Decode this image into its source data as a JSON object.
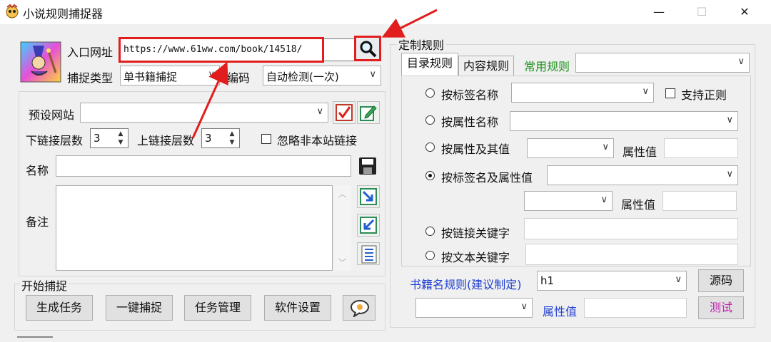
{
  "window": {
    "title": "小说规则捕捉器",
    "min_glyph": "—",
    "max_glyph": "☐",
    "close_glyph": "✕"
  },
  "left": {
    "entry_label": "入口网址",
    "entry_url": "https://www.61ww.com/book/14518/",
    "capture_type_label": "捕捉类型",
    "capture_type_value": "单书籍捕捉",
    "encoding_label": "编码",
    "encoding_value": "自动检测(一次)",
    "preset_site_label": "预设网站",
    "preset_site_value": "",
    "down_link_label": "下链接层数",
    "down_link_value": "3",
    "up_link_label": "上链接层数",
    "up_link_value": "3",
    "ignore_external_label": "忽略非本站链接",
    "name_label": "名称",
    "name_value": "",
    "remark_label": "备注",
    "remark_value": ""
  },
  "start": {
    "group_label": "开始捕捉",
    "buttons": [
      "生成任务",
      "一键捕捉",
      "任务管理",
      "软件设置"
    ]
  },
  "rules": {
    "group_label": "定制规则",
    "tabs": [
      "目录规则",
      "内容规则"
    ],
    "common_rules_label": "常用规则",
    "common_rules_value": "",
    "by_tag_name": "按标签名称",
    "support_regex": "支持正则",
    "by_attr_name": "按属性名称",
    "by_attr_and_value": "按属性及其值",
    "attr_value_label": "属性值",
    "by_tag_and_attr": "按标签名及属性值",
    "by_link_keyword": "按链接关键字",
    "by_text_keyword": "按文本关键字",
    "book_name_rule_label": "书籍名规则(建议制定)",
    "book_name_rule_value": "h1",
    "source_button": "源码",
    "test_button": "测试",
    "blue_attr_label": "属性值"
  },
  "colors": {
    "annotation_red": "#e11d1d",
    "green_label": "#1a8f1a",
    "blue_label": "#1f3fd0",
    "test_button_text": "#c21fb2"
  }
}
